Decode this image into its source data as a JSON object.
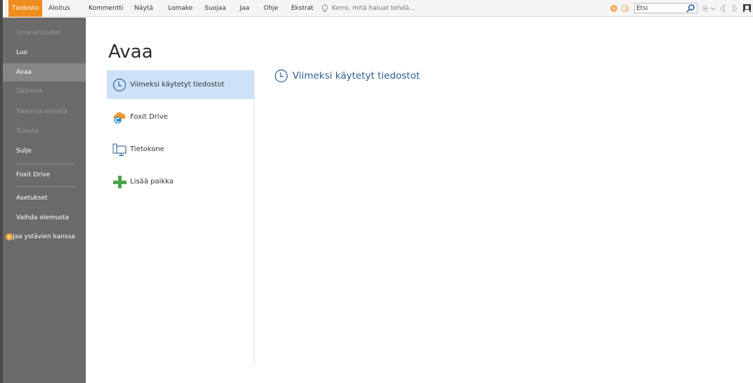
{
  "ribbon": {
    "tabs": [
      {
        "label": "Tiedosto"
      },
      {
        "label": "Aloitus"
      },
      {
        "label": "Kommentti"
      },
      {
        "label": "Näytä"
      },
      {
        "label": "Lomake"
      },
      {
        "label": "Suojaa"
      },
      {
        "label": "Jaa"
      },
      {
        "label": "Ohje"
      },
      {
        "label": "Ekstrat"
      }
    ],
    "tell_me_placeholder": "Kerro, mitä haluat tehdä...",
    "search_value": "Etsi"
  },
  "sidebar": {
    "items": [
      {
        "label": "Ominaisuudet"
      },
      {
        "label": "Luo"
      },
      {
        "label": "Avaa"
      },
      {
        "label": "Tallenna"
      },
      {
        "label": "Tallenna nimellä"
      },
      {
        "label": "Tulosta"
      },
      {
        "label": "Sulje"
      },
      {
        "label": "Foxit Drive"
      },
      {
        "label": "Asetukset"
      },
      {
        "label": "Vaihda olemusta"
      },
      {
        "label": "Jaa ystävien kanssa"
      }
    ]
  },
  "main": {
    "title": "Avaa",
    "places": [
      {
        "label": "Viimeksi käytetyt tiedostot",
        "icon": "clock-icon"
      },
      {
        "label": "Foxit Drive",
        "icon": "foxit-drive-icon"
      },
      {
        "label": "Tietokone",
        "icon": "computer-icon"
      },
      {
        "label": "Lisää paikka",
        "icon": "plus-icon"
      }
    ],
    "recent_title": "Viimeksi käytetyt tiedostot"
  },
  "colors": {
    "accent": "#f08b1d",
    "sidebar_bg": "#6b6b6b",
    "selected_place": "#cde1f7",
    "heading_blue": "#2f5f8f"
  }
}
